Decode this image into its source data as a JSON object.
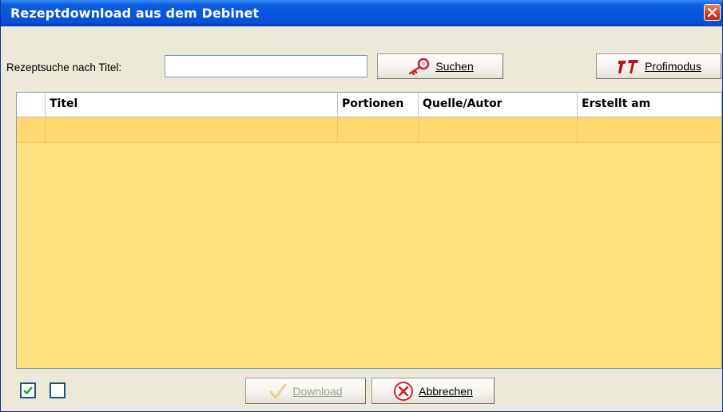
{
  "window": {
    "title": "Rezeptdownload aus dem Debinet"
  },
  "search": {
    "label": "Rezeptsuche nach Titel:",
    "value": "",
    "placeholder": "",
    "button_label": "Suchen"
  },
  "profi_button": {
    "label": "Profimodus"
  },
  "table": {
    "columns": [
      "",
      "Titel",
      "Portionen",
      "Quelle/Autor",
      "Erstellt am"
    ],
    "rows": [
      [
        "",
        "",
        "",
        "",
        ""
      ]
    ]
  },
  "footer": {
    "select_all_checked": true,
    "deselect_checked": false,
    "download_label": "Download",
    "download_enabled": false,
    "cancel_label": "Abbrechen"
  },
  "colors": {
    "titlebar": "#0855DD",
    "grid_background": "#FFE07E",
    "selected_row": "#FFD870",
    "window_face": "#ECE9D8"
  },
  "icons": {
    "search": "key-icon",
    "profi": "tools-icon",
    "download": "checkmark-icon",
    "cancel": "cancel-circle-icon",
    "close": "close-icon"
  }
}
